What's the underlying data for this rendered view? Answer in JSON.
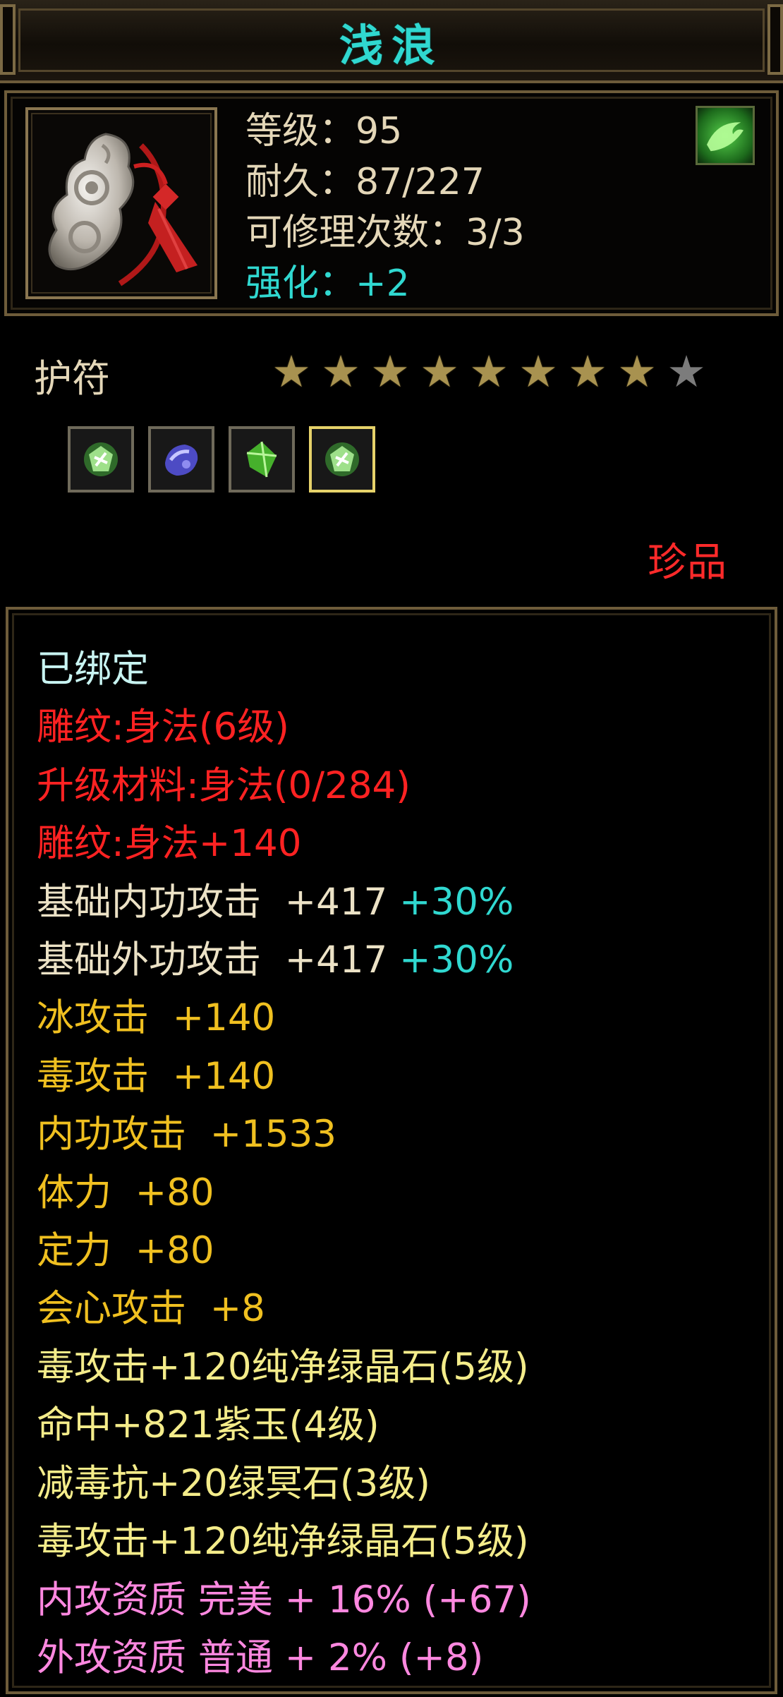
{
  "title": "浅浪",
  "item": {
    "level_text": "等级：95",
    "durability_text": "耐久：87/227",
    "repair_text": "可修理次数：3/3",
    "enhance_text": "强化：+2",
    "icon": "jade-amulet-icon",
    "badge_icon": "green-swirl-icon"
  },
  "type_label": "护符",
  "stars": {
    "filled": 8,
    "total": 9
  },
  "sockets": [
    {
      "icon": "green-crystal-gem-icon",
      "selected": false
    },
    {
      "icon": "purple-jade-gem-icon",
      "selected": false
    },
    {
      "icon": "green-stone-gem-icon",
      "selected": false
    },
    {
      "icon": "green-crystal-gem-icon",
      "selected": true
    }
  ],
  "rarity": "珍品",
  "attributes": {
    "bound": "已绑定",
    "engrave_1": "雕纹:身法(6级)",
    "upgrade_material": "升级材料:身法(0/284)",
    "engrave_2": "雕纹:身法+140",
    "inner_attack_base": "基础内功攻击  +417 ",
    "inner_attack_pct": "+30%",
    "outer_attack_base": "基础外功攻击  +417 ",
    "outer_attack_pct": "+30%",
    "ice_attack": "冰攻击  +140",
    "poison_attack": "毒攻击  +140",
    "inner_attack": "内功攻击  +1533",
    "stamina": "体力  +80",
    "focus": "定力  +80",
    "crit": "会心攻击  +8",
    "gem_1": "毒攻击+120纯净绿晶石(5级)",
    "gem_2": "命中+821紫玉(4级)",
    "gem_3": "减毒抗+20绿冥石(3级)",
    "gem_4": "毒攻击+120纯净绿晶石(5级)",
    "quality_inner": "内攻资质 完美 + 16% (+67)",
    "quality_outer": "外攻资质 普通 + 2% (+8)"
  },
  "colors": {
    "title": "#30d8d0",
    "rarity": "#ff2a2a",
    "engrave": "#ff2222",
    "base_stat": "#ece2c6",
    "bonus_stat": "#f0c020",
    "gem_stat": "#f4ec8a",
    "quality": "#ff88e0"
  }
}
